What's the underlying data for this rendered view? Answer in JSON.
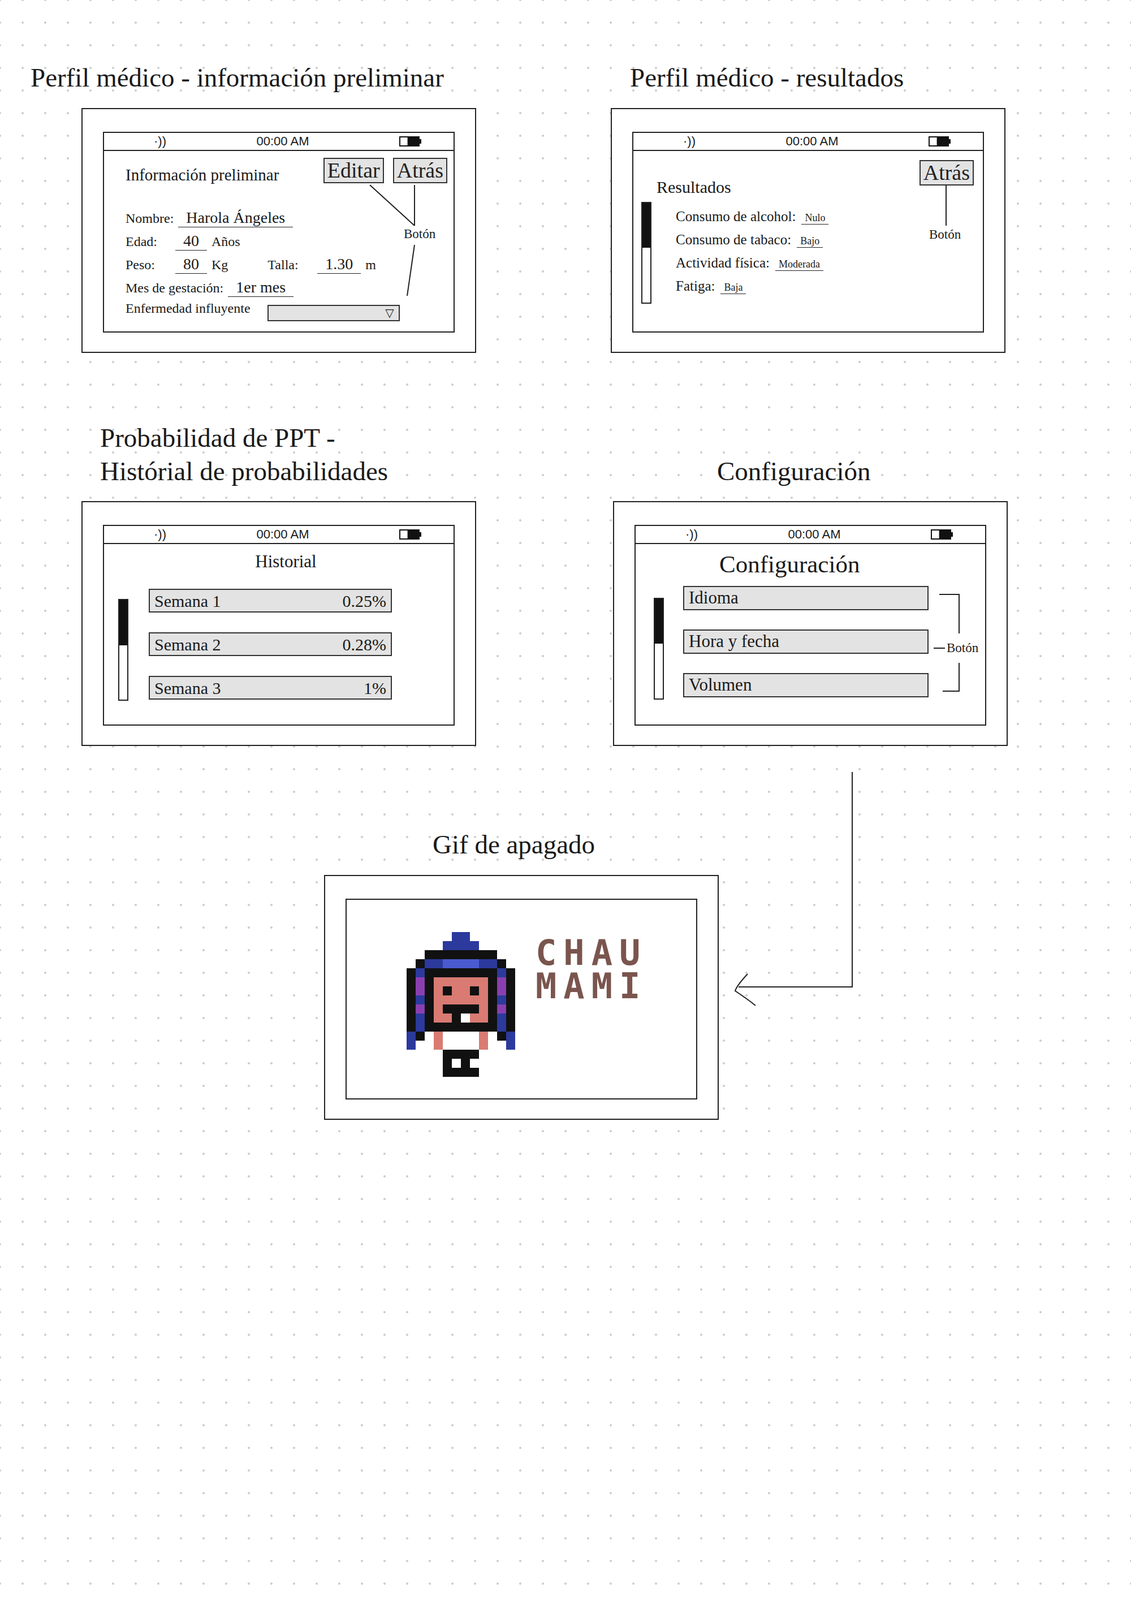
{
  "preliminary": {
    "heading": [
      "Perfil médico - información preliminar"
    ],
    "status_bar": {
      "signal": "·))",
      "time": "00:00 AM",
      "battery_level": 0.6
    },
    "title": "Información preliminar",
    "buttons": [
      "Editar",
      "Atrás"
    ],
    "annotation": "Botón",
    "rows": [
      {
        "fields": [
          {
            "kind": "text",
            "label": "Nombre:",
            "value": "Harola Ángeles"
          }
        ]
      },
      {
        "fields": [
          {
            "kind": "text",
            "label": "Edad:",
            "value": "40",
            "unit": "Años"
          }
        ]
      },
      {
        "fields": [
          {
            "kind": "text",
            "label": "Peso:",
            "value": "80",
            "unit": "Kg"
          },
          {
            "kind": "text",
            "label": "Talla:",
            "value": "1.30",
            "unit": "m"
          }
        ]
      },
      {
        "fields": [
          {
            "kind": "text",
            "label": "Mes de gestación:",
            "value": "1er mes"
          }
        ]
      },
      {
        "fields": [
          {
            "kind": "dropdown",
            "label": "Enfermedad influyente",
            "value": "",
            "arrow": "▽"
          }
        ]
      }
    ]
  },
  "results": {
    "heading": [
      "Perfil médico - resultados"
    ],
    "status_bar": {
      "signal": "·))",
      "time": "00:00 AM",
      "battery_level": 0.6
    },
    "title": "Resultados",
    "button": "Atrás",
    "annotation": "Botón",
    "scrollbar": {
      "level": 0.45
    },
    "items": [
      {
        "label": "Consumo de alcohol:",
        "value": "Nulo"
      },
      {
        "label": "Consumo de tabaco:",
        "value": "Bajo"
      },
      {
        "label": "Actividad física:",
        "value": "Moderada"
      },
      {
        "label": "Fatiga:",
        "value": "Baja"
      }
    ]
  },
  "history": {
    "heading": [
      "Probabilidad de PPT -",
      "Histórial de probabilidades"
    ],
    "status_bar": {
      "signal": "·))",
      "time": "00:00 AM",
      "battery_level": 0.6
    },
    "title": "Historial",
    "scrollbar": {
      "level": 0.45
    },
    "rows": [
      {
        "label": "Semana 1",
        "value": "0.25%"
      },
      {
        "label": "Semana 2",
        "value": "0.28%"
      },
      {
        "label": "Semana 3",
        "value": "1%"
      }
    ]
  },
  "settings": {
    "heading": [
      "Configuración"
    ],
    "status_bar": {
      "signal": "·))",
      "time": "00:00 AM",
      "battery_level": 0.6
    },
    "title": "Configuración",
    "scrollbar": {
      "level": 0.45
    },
    "options": [
      "Idioma",
      "Hora y fecha",
      "Volumen"
    ],
    "annotation": "Botón"
  },
  "goodbye": {
    "heading": [
      "Gif de apagado"
    ],
    "message": [
      "CHAU",
      "MAMI"
    ]
  }
}
